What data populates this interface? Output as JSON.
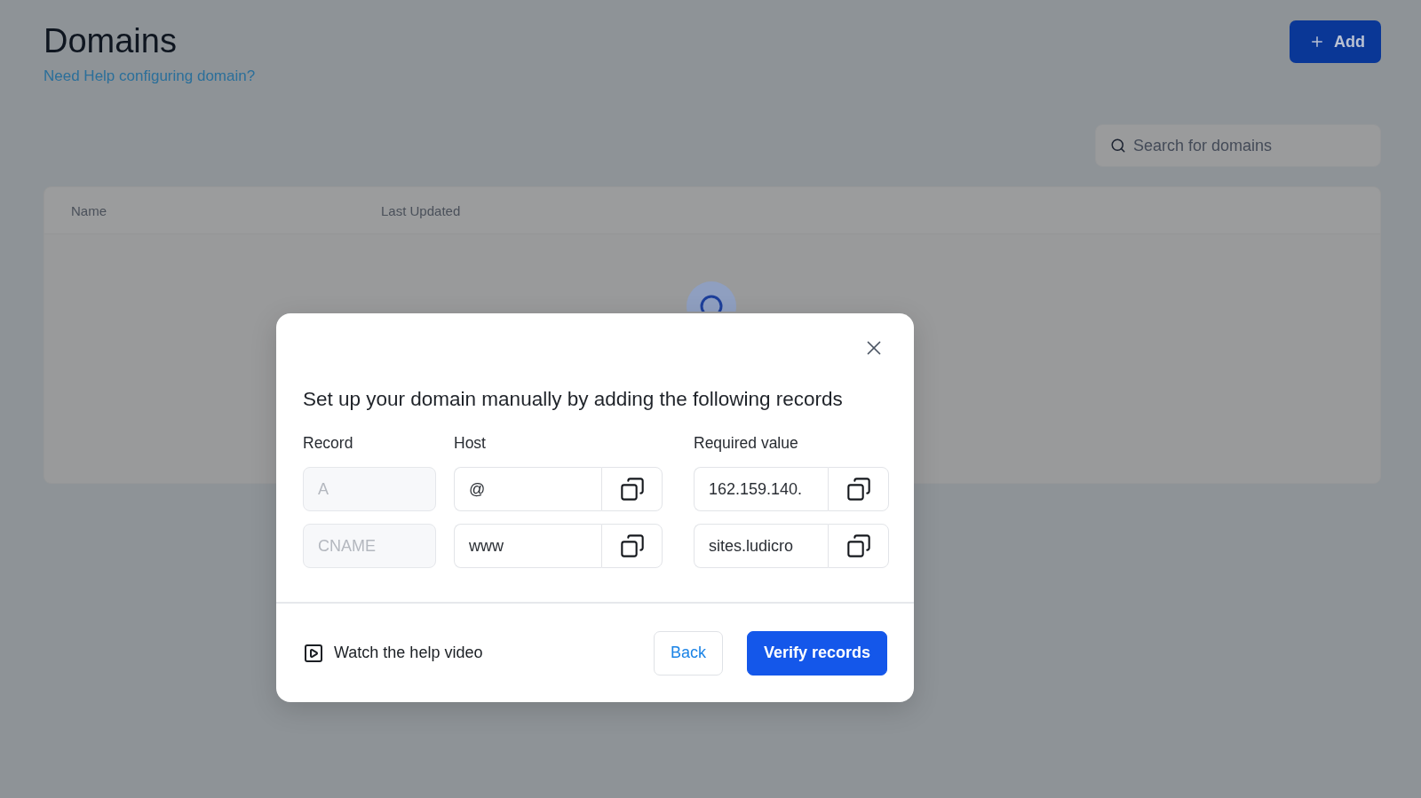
{
  "page": {
    "title": "Domains",
    "help_link": "Need Help configuring domain?",
    "add_button": "Add",
    "search": {
      "placeholder": "Search for domains"
    },
    "table": {
      "columns": [
        "Name",
        "Last Updated"
      ],
      "loading": true
    }
  },
  "dialog": {
    "heading": "Set up your domain manually by adding the following records",
    "columns": [
      "Record",
      "Host",
      "Required value"
    ],
    "records": [
      {
        "type": "A",
        "type_disabled": true,
        "host": "@",
        "value": "162.159.140."
      },
      {
        "type": "CNAME",
        "type_disabled": true,
        "host": "www",
        "value": "sites.ludicro"
      }
    ],
    "help_video": "Watch the help video",
    "buttons": [
      {
        "label": "Back",
        "kind": "secondary"
      },
      {
        "label": "Verify records",
        "kind": "primary"
      }
    ]
  }
}
